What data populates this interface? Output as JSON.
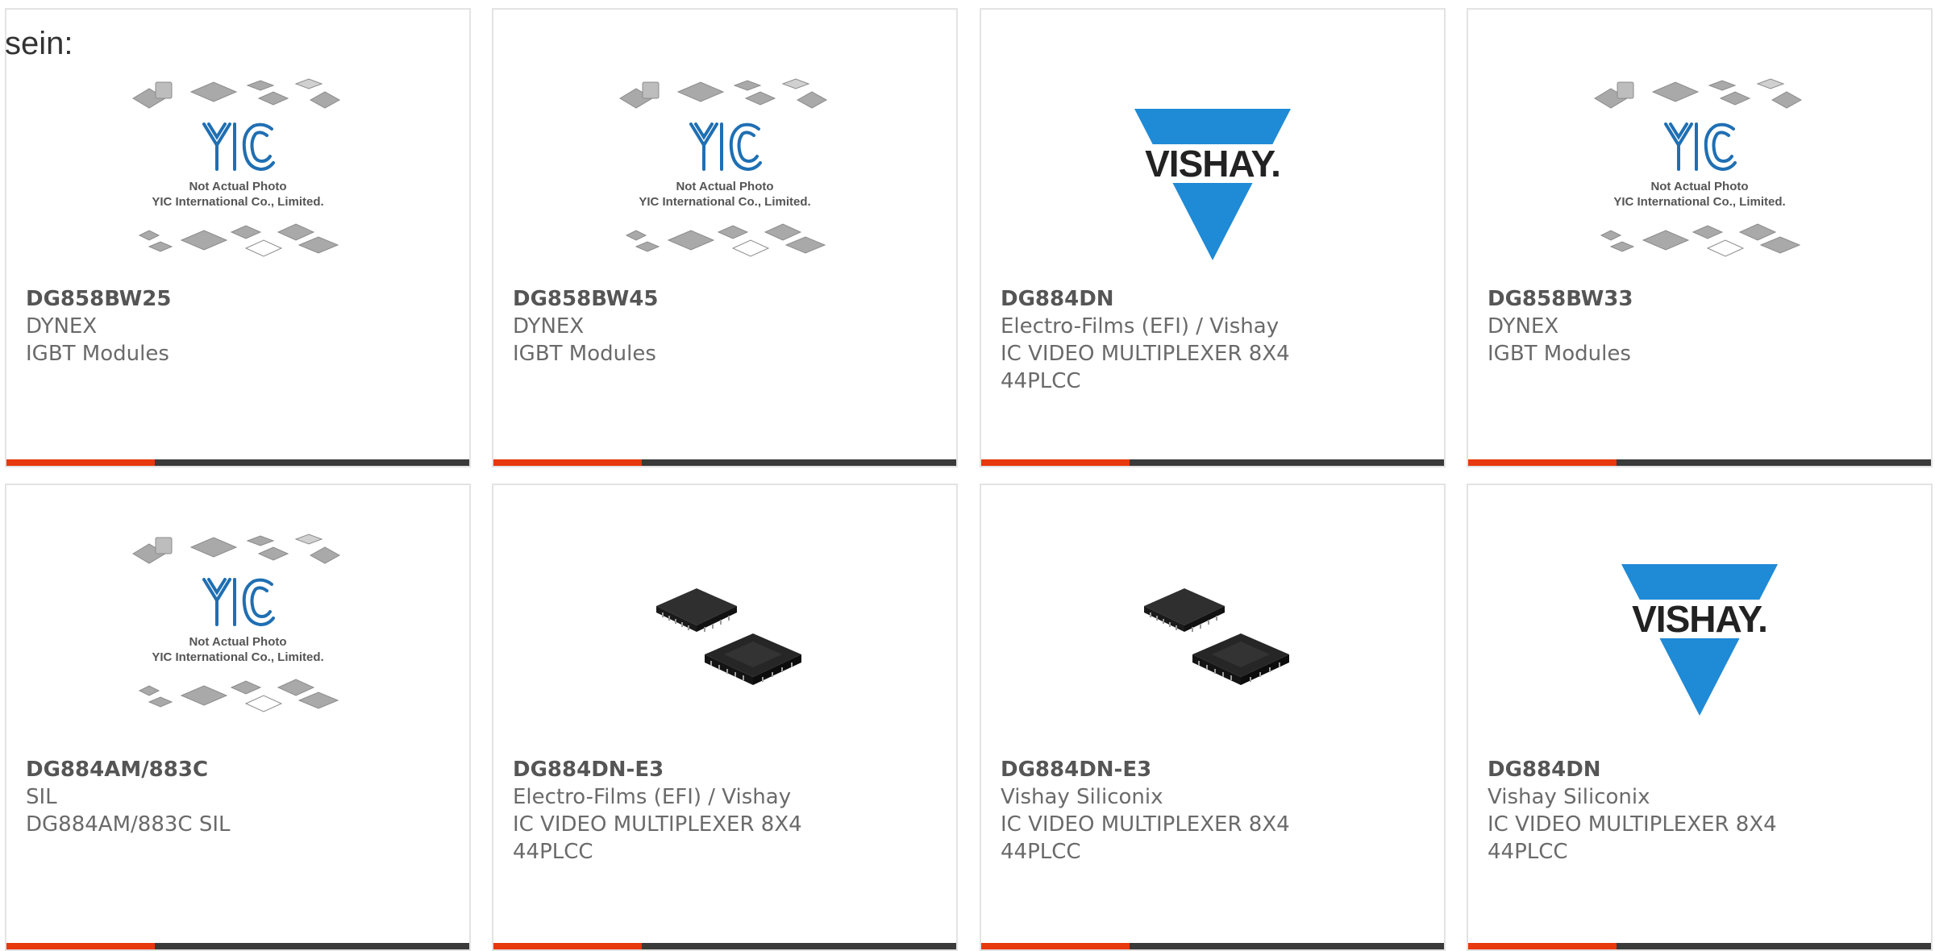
{
  "intro_text": "sein:",
  "placeholder": {
    "line1": "Not Actual Photo",
    "line2": "YIC International Co., Limited."
  },
  "vishay_logo_text": "VISHAY.",
  "colors": {
    "accent": "#e8380d",
    "bar": "#3a3a3a",
    "yic_blue": "#1f6fb3",
    "vishay_blue": "#1f8ad6"
  },
  "products": [
    {
      "part": "DG858BW25",
      "maker": "DYNEX",
      "desc": [
        "IGBT Modules"
      ],
      "image": "yic-placeholder"
    },
    {
      "part": "DG858BW45",
      "maker": "DYNEX",
      "desc": [
        "IGBT Modules"
      ],
      "image": "yic-placeholder"
    },
    {
      "part": "DG884DN",
      "maker": "Electro-Films (EFI) / Vishay",
      "desc": [
        "IC VIDEO MULTIPLEXER 8X4",
        "44PLCC"
      ],
      "image": "vishay-logo"
    },
    {
      "part": "DG858BW33",
      "maker": "DYNEX",
      "desc": [
        "IGBT Modules"
      ],
      "image": "yic-placeholder"
    },
    {
      "part": "DG884AM/883C",
      "maker": "SIL",
      "desc": [
        "DG884AM/883C SIL"
      ],
      "image": "yic-placeholder"
    },
    {
      "part": "DG884DN-E3",
      "maker": "Electro-Films (EFI) / Vishay",
      "desc": [
        "IC VIDEO MULTIPLEXER 8X4",
        "44PLCC"
      ],
      "image": "plcc-chip"
    },
    {
      "part": "DG884DN-E3",
      "maker": "Vishay Siliconix",
      "desc": [
        "IC VIDEO MULTIPLEXER 8X4",
        "44PLCC"
      ],
      "image": "plcc-chip"
    },
    {
      "part": "DG884DN",
      "maker": "Vishay Siliconix",
      "desc": [
        "IC VIDEO MULTIPLEXER 8X4",
        "44PLCC"
      ],
      "image": "vishay-logo"
    }
  ]
}
